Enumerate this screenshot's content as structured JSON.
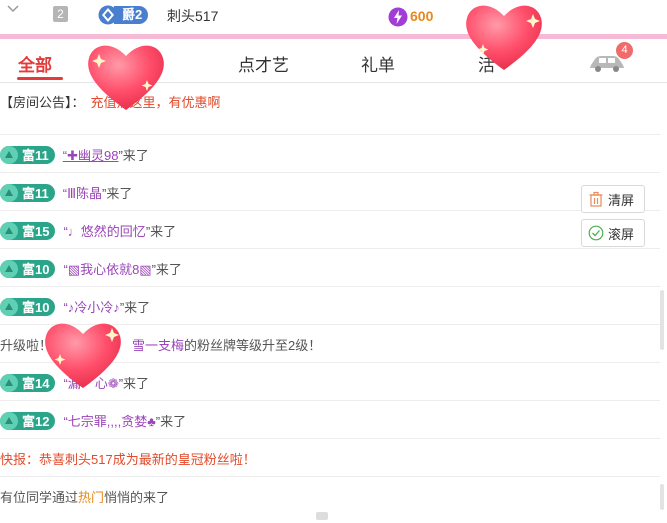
{
  "topbar": {
    "rank_num": "2",
    "noble_label": "爵2",
    "username": "刺头517",
    "coin_value": "600"
  },
  "tabs": [
    {
      "label": "全部",
      "active": true
    },
    {
      "label": "点才艺",
      "active": false
    },
    {
      "label": "礼单",
      "active": false
    },
    {
      "label": "活",
      "active": false
    }
  ],
  "car_badge": "4",
  "announcement": {
    "prefix": "【房间公告】：",
    "text": "充值点这里，有优惠啊"
  },
  "messages": [
    {
      "level": "富11",
      "nick": "“✚幽灵98",
      "suffix": "”来了",
      "underline": true
    },
    {
      "level": "富11",
      "nick": "“Ⅲ陈晶",
      "suffix": "”来了",
      "underline": false
    },
    {
      "level": "富15",
      "nick": "“♩悠然的回忆",
      "suffix": "”来了",
      "underline": false
    },
    {
      "level": "富10",
      "nick": "“▧我心依就8▧",
      "suffix": "”来了",
      "underline": false
    },
    {
      "level": "富10",
      "nick": "“♪冷小冷♪",
      "suffix": "”来了",
      "underline": false
    }
  ],
  "upgrade_msg": {
    "prefix": "升级啦！",
    "name": "雪一支梅",
    "suffix": "的粉丝牌等级升至2级！"
  },
  "messages2": [
    {
      "level": "富14",
      "nick": "“漏",
      "mid": "心❁",
      "suffix": "”来了"
    },
    {
      "level": "富12",
      "nick": "“七宗罪,,,,贪婪♣",
      "suffix": "”来了"
    }
  ],
  "news": {
    "prefix": "快报：恭喜 ",
    "name": "刺头517",
    "suffix": " 成为最新的皇冠粉丝啦！"
  },
  "hot_msg": {
    "prefix": "有位同学通过 ",
    "link": "热门",
    "suffix": " 悄悄的来了"
  },
  "side_buttons": {
    "clear_label": "清屏",
    "scroll_label": "滚屏"
  },
  "colors": {
    "accent_red": "#e33b3b",
    "badge_green": "#2aa58a",
    "nick_purple": "#9a45b8",
    "pink_line": "#f6b9d6"
  }
}
